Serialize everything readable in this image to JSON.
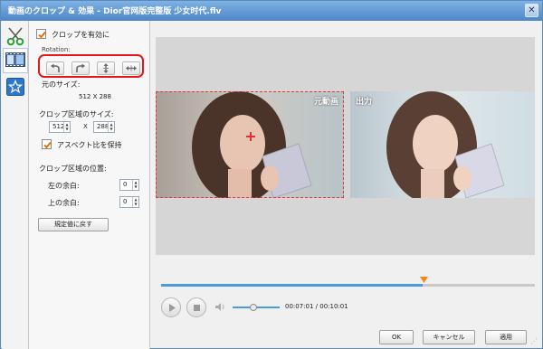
{
  "window": {
    "title": "動画のクロップ & 効果 - Dior官网版完整版 少女时代.flv",
    "close_label": "✕"
  },
  "tabs": [
    {
      "name": "crop",
      "icon": "scissors-icon"
    },
    {
      "name": "effects",
      "icon": "film-icon",
      "active": true
    },
    {
      "name": "watermark",
      "icon": "star-icon"
    }
  ],
  "crop": {
    "enable_label": "クロップを有効に",
    "enable_checked": true,
    "rotation_label": "Rotation:",
    "rotation_buttons": [
      "rotate-left-icon",
      "rotate-right-icon",
      "flip-vertical-icon",
      "flip-horizontal-icon"
    ],
    "original_size_label": "元のサイズ:",
    "original_size_value": "512 X 288",
    "crop_size_label": "クロップ区域のサイズ:",
    "crop_width": "512",
    "crop_x": "X",
    "crop_height": "288",
    "keep_aspect_label": "アスペクト比を保持",
    "keep_aspect_checked": true,
    "position_label": "クロップ区域の位置:",
    "left_margin_label": "左の余白:",
    "left_margin_value": "0",
    "top_margin_label": "上の余白:",
    "top_margin_value": "0",
    "reset_label": "規定値に戻す"
  },
  "preview": {
    "original_label": "元動画",
    "output_label": "出力"
  },
  "player": {
    "time": "00:07:01 / 00:10:01",
    "progress": 0.7
  },
  "buttons": {
    "ok": "OK",
    "cancel": "キャンセル",
    "apply": "適用"
  },
  "colors": {
    "accent": "#4a9ae0",
    "highlight": "#e3171a",
    "titlebar": "#4d86c6"
  }
}
